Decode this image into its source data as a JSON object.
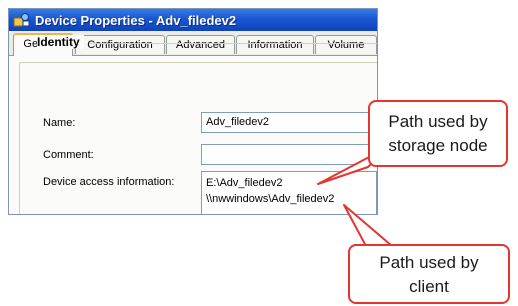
{
  "window": {
    "title": "Device Properties - Adv_filedev2"
  },
  "tabs": [
    {
      "label": "General",
      "active": true
    },
    {
      "label": "Configuration",
      "active": false
    },
    {
      "label": "Advanced",
      "active": false
    },
    {
      "label": "Information",
      "active": false
    },
    {
      "label": "Volume",
      "active": false
    }
  ],
  "identity": {
    "group_title": "Identity",
    "name_label": "Name:",
    "name_value": "Adv_filedev2",
    "comment_label": "Comment:",
    "comment_value": "",
    "access_label": "Device access information:",
    "access_lines": [
      "E:\\Adv_filedev2",
      "\\\\nwwindows\\Adv_filedev2"
    ]
  },
  "callouts": {
    "storage_node_lines": [
      "Path used by",
      "storage node"
    ],
    "client_lines": [
      "Path used by",
      "client"
    ]
  },
  "colors": {
    "callout_border": "#e2362f",
    "titlebar": "#1956d2",
    "active_tab_accent": "#f2b34a"
  }
}
